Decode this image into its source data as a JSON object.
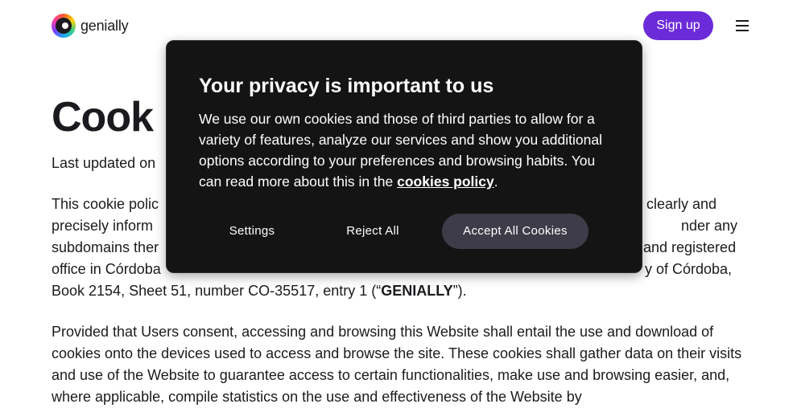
{
  "header": {
    "logo_text": "genially",
    "signup_label": "Sign up"
  },
  "main": {
    "title": "Cook",
    "updated": "Last updated on",
    "p1_start": "This cookie polic",
    "p1_right1": "clearly and",
    "p1_l2": "precisely inform",
    "p1_right2": "nder any",
    "p1_l3": "subdomains ther",
    "p1_right3": "and registered",
    "p1_l4": "office in Córdoba",
    "p1_right4": "y of Córdoba,",
    "p1_l5_pre": "Book 2154, Sheet 51, number CO-35517, entry 1 (“",
    "p1_l5_bold": "GENIALLY",
    "p1_l5_post": "”).",
    "p2": "Provided that Users consent, accessing and browsing this Website shall entail the use and download of cookies onto the devices used to access and browse the site. These cookies shall gather data on their visits and use of the Website to guarantee access to certain functionalities, make use and browsing easier, and, where applicable, compile statistics on the use and effectiveness of the Website by"
  },
  "consent": {
    "title": "Your privacy is important to us",
    "body_pre": "We use our own cookies and those of third parties to allow for a variety of features, analyze our services and show you additional options according to your preferences and browsing habits. You can read more about this in the ",
    "link_label": "cookies policy",
    "body_post": ".",
    "settings_label": "Settings",
    "reject_label": "Reject All",
    "accept_label": "Accept All Cookies"
  },
  "colors": {
    "brand": "#6c2bd9",
    "modal_bg": "#141414",
    "accept_bg": "#3d3c48"
  },
  "icons": [
    "genially-logo-icon",
    "menu-icon"
  ]
}
